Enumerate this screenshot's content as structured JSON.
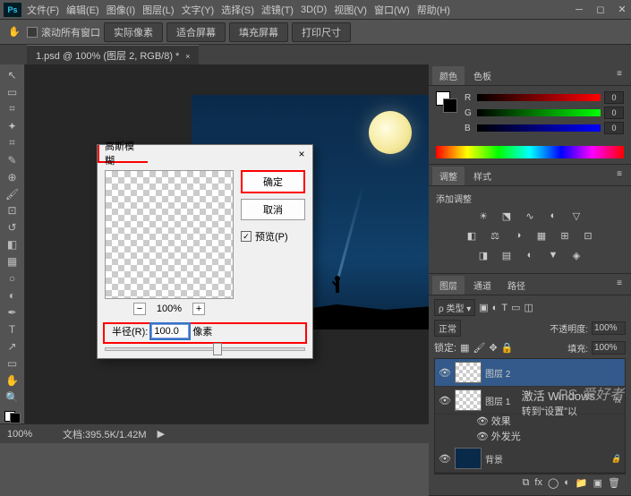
{
  "menu": {
    "items": [
      "文件(F)",
      "编辑(E)",
      "图像(I)",
      "图层(L)",
      "文字(Y)",
      "选择(S)",
      "滤镜(T)",
      "3D(D)",
      "视图(V)",
      "窗口(W)",
      "帮助(H)"
    ]
  },
  "options": {
    "scroll": "滚动所有窗口",
    "b1": "实际像素",
    "b2": "适合屏幕",
    "b3": "填充屏幕",
    "b4": "打印尺寸"
  },
  "tab": {
    "title": "1.psd @ 100% (图层 2, RGB/8) *"
  },
  "panels": {
    "color": {
      "t1": "颜色",
      "t2": "色板",
      "r": "R",
      "g": "G",
      "b": "B",
      "v": "0"
    },
    "adjust": {
      "t1": "调整",
      "t2": "样式",
      "add": "添加调整"
    },
    "layers": {
      "t1": "图层",
      "t2": "通道",
      "t3": "路径",
      "mode": "正常",
      "opacity": "不透明度:",
      "opv": "100%",
      "lock": "锁定:",
      "fill": "填充:",
      "fillv": "100%",
      "items": [
        {
          "name": "图层 2",
          "fx": "",
          "sel": true,
          "bg": "chk"
        },
        {
          "name": "图层 1",
          "fx": "fx",
          "sel": false,
          "bg": "chk",
          "sub": [
            "效果",
            "外发光"
          ]
        },
        {
          "name": "背景",
          "fx": "🔒",
          "sel": false,
          "bg": "img"
        }
      ]
    }
  },
  "status": {
    "zoom": "100%",
    "doc": "文档:395.5K/1.42M"
  },
  "dialog": {
    "title": "高斯模糊",
    "ok": "确定",
    "cancel": "取消",
    "preview": "预览(P)",
    "zoom": "100%",
    "radius_label": "半径(R):",
    "radius_value": "100.0",
    "radius_unit": "像素"
  },
  "watermark": {
    "l1": "激活 Windows",
    "l2": "转到“设置”以",
    "brand": "PS 爱好者"
  }
}
